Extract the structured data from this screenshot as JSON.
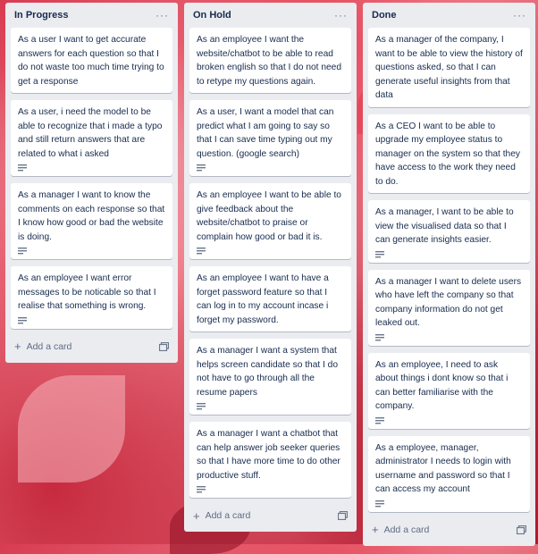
{
  "lists": [
    {
      "title": "In Progress",
      "menu": "···",
      "add_card": "Add a card",
      "cards": [
        {
          "text": "As a user I want to get accurate answers for each question so that I do not waste too much time trying to get a response",
          "has_description": false
        },
        {
          "text": "As a user, i need the model to be able to recognize that i made a typo and still return answers that are related to what i asked",
          "has_description": true
        },
        {
          "text": "As a manager I want to know the comments on each response so that I know how good or bad the website is doing.",
          "has_description": true
        },
        {
          "text": "As an employee I want error messages to be noticable so that I realise that something is wrong.",
          "has_description": true
        }
      ]
    },
    {
      "title": "On Hold",
      "menu": "···",
      "add_card": "Add a card",
      "cards": [
        {
          "text": "As an employee I want the website/chatbot to be able to read broken english so that I do not need to retype my questions again.",
          "has_description": false
        },
        {
          "text": "As a user, I want a model that can predict what I am going to say so that I can save time typing out my question. (google search)",
          "has_description": true
        },
        {
          "text": "As an employee I want to be able to give feedback about the website/chatbot to praise or complain how good or bad it is.",
          "has_description": true
        },
        {
          "text": "As an employee I want to have a forget password feature so that I can log in to my account incase i forget my password.",
          "has_description": false
        },
        {
          "text": "As a manager I want a system that helps screen candidate so that I do not have to go through all the resume papers",
          "has_description": true
        },
        {
          "text": "As a manager I want a chatbot that can help answer job seeker queries so that I have more time to do other productive stuff.",
          "has_description": true
        }
      ]
    },
    {
      "title": "Done",
      "menu": "···",
      "add_card": "Add a card",
      "cards": [
        {
          "text": "As a manager of the company, I want to be able to view the history of questions asked, so that I can generate useful insights from that data",
          "has_description": false
        },
        {
          "text": "As a CEO I want to be able to upgrade my employee status to manager on the system so that they have access to the work they need to do.",
          "has_description": false
        },
        {
          "text": "As a manager, I want to be able to view the visualised data so that I can generate insights easier.",
          "has_description": true
        },
        {
          "text": "As a manager I want to delete users who have left the company so that company information do not get leaked out.",
          "has_description": true
        },
        {
          "text": "As an employee, I need to ask about things i dont know so that i can better familiarise with the company.",
          "has_description": true
        },
        {
          "text": "As a employee, manager, administrator I needs to login with username and password so that I can access my account",
          "has_description": true
        }
      ]
    }
  ],
  "icons": {
    "description": "description-icon",
    "template": "card-template-icon",
    "menu": "list-menu-icon",
    "add": "plus-icon"
  },
  "colors": {
    "list_bg": "#ebecf0",
    "card_bg": "#ffffff",
    "text": "#172b4d",
    "muted": "#5e6c84",
    "background": "#d83c52"
  }
}
